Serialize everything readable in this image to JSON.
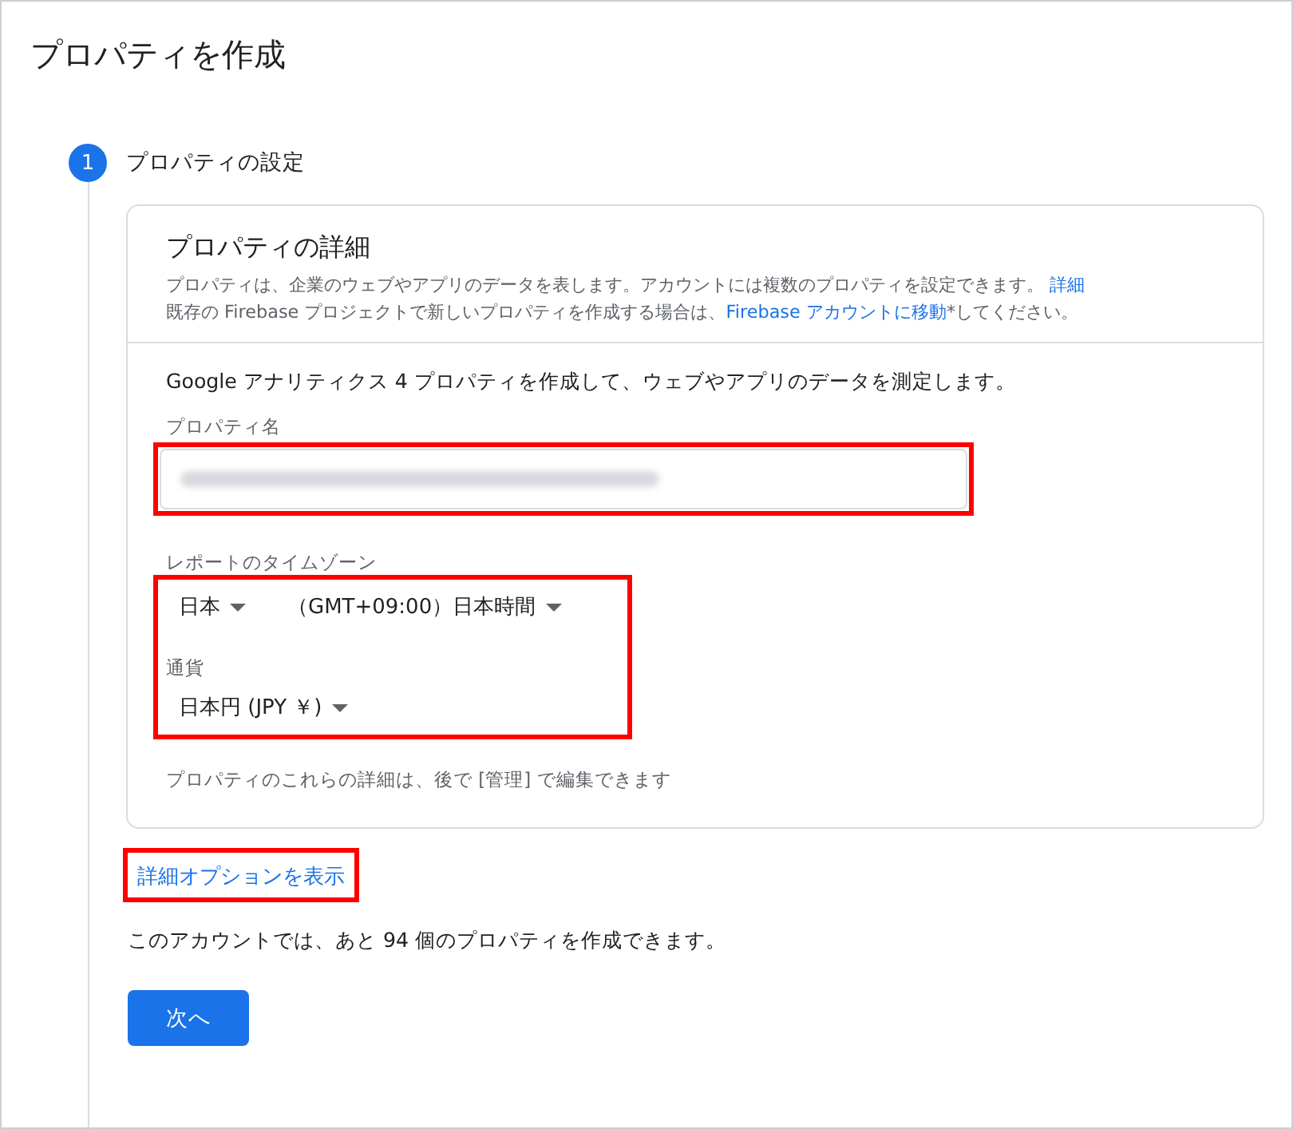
{
  "page": {
    "title": "プロパティを作成"
  },
  "step": {
    "number": "1",
    "label": "プロパティの設定",
    "active": true
  },
  "details": {
    "heading": "プロパティの詳細",
    "lines": [
      {
        "before": "プロパティは、企業のウェブやアプリのデータを表します。アカウントには複数のプロパティを設定できます。 ",
        "link": "詳細"
      },
      {
        "before": "既存の Firebase プロジェクトで新しいプロパティを作成する場合は、",
        "link": "Firebase アカウントに移動",
        "after": "*してください。"
      }
    ]
  },
  "intro": "Google アナリティクス 4 プロパティを作成して、ウェブやアプリのデータを測定します。",
  "property_name": {
    "label": "プロパティ名",
    "highlighted": true
  },
  "regional": {
    "highlighted": true,
    "timezone_label": "レポートのタイムゾーン",
    "country": "日本",
    "zone": "（GMT+09:00）日本時間",
    "currency_label": "通貨",
    "currency": "日本円 (JPY ￥)"
  },
  "note": "プロパティのこれらの詳細は、後で [管理] で編集できます",
  "advanced_link": {
    "label": "詳細オプションを表示",
    "highlighted": true
  },
  "quota": "このアカウントでは、あと 94 個のプロパティを作成できます。",
  "next_button": "次へ"
}
